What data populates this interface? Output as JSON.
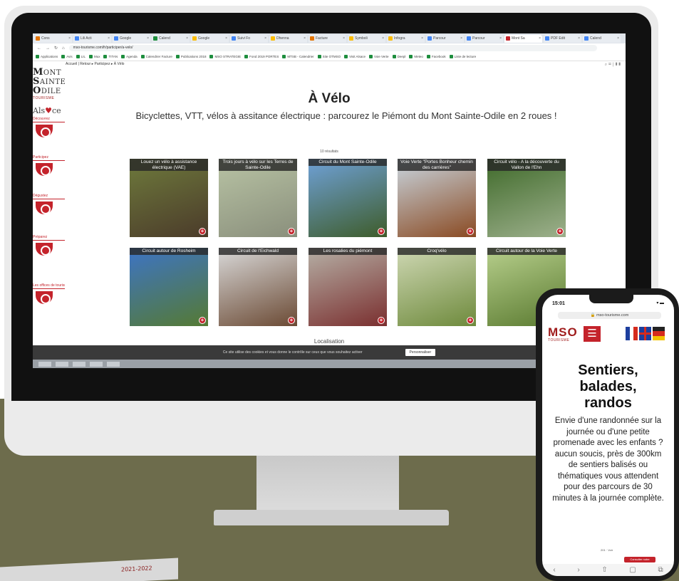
{
  "browser": {
    "tabs": [
      {
        "label": "Cons",
        "color": "#e37400"
      },
      {
        "label": "Lili Acti",
        "color": "#4285f4"
      },
      {
        "label": "Google",
        "color": "#4285f4"
      },
      {
        "label": "Calend",
        "color": "#1e8e3e"
      },
      {
        "label": "Google",
        "color": "#fbbc04"
      },
      {
        "label": "Suivi Fo",
        "color": "#4285f4"
      },
      {
        "label": "Dhenna",
        "color": "#fbbc04"
      },
      {
        "label": "Facture",
        "color": "#e37400"
      },
      {
        "label": "Symboli",
        "color": "#fbbc04"
      },
      {
        "label": "Infogra",
        "color": "#fbbc04"
      },
      {
        "label": "Parcour",
        "color": "#4285f4"
      },
      {
        "label": "Parcour",
        "color": "#4285f4"
      },
      {
        "label": "Mont Sa",
        "color": "#c4232b",
        "active": true
      },
      {
        "label": "PDF Edit",
        "color": "#4285f4"
      },
      {
        "label": "Calend",
        "color": "#4285f4"
      }
    ],
    "url": "mso-tourisme.com/fr/participer/a-velo/",
    "bookmarks": [
      "Applications",
      "Avis",
      "LIL",
      "Mux",
      "TITAN",
      "Agenda",
      "Calendrier Facture",
      "Publications 2018",
      "MSO STRATEGIE",
      "Fond 2019 PORTES",
      "MTSB - Calendrier",
      "Site OTMSO",
      "Visit Alsace",
      "Voie Verte",
      "Deepl",
      "Meteo",
      "Facebook",
      "Liste de lecture"
    ]
  },
  "site": {
    "breadcrumb": "Accueil | Retour ▸ Participez ▸ À Vélo",
    "header_icons": "⌕ ✉ | ▮▮",
    "logo": {
      "lines": [
        {
          "cap": "M",
          "rest": "ONT"
        },
        {
          "cap": "S",
          "rest": "AINTE"
        },
        {
          "cap": "O",
          "rest": "DILE"
        }
      ],
      "tourisme": "TOURISME",
      "alsace_pre": "Als",
      "alsace_heart": "♥",
      "alsace_post": "ce"
    },
    "sidebar": [
      {
        "label": "Découvrez",
        "icon": "camera-icon"
      },
      {
        "label": "Participez",
        "icon": "bike-icon"
      },
      {
        "label": "Dégustez",
        "icon": "grapes-icon"
      },
      {
        "label": "Préparez",
        "icon": "suitcase-icon"
      },
      {
        "label": "Les offices de tourisme",
        "icon": "info-icon"
      }
    ],
    "title": "À Vélo",
    "subtitle": "Bicyclettes, VTT, vélos à assitance électrique : parcourez le Piémont du Mont Sainte-Odile en 2 roues !",
    "results": "10 résultats",
    "cards": [
      {
        "label": "Louez un vélo à assistance électrique (VAE)",
        "colors": [
          "#6e7a3c",
          "#4b3b2a"
        ]
      },
      {
        "label": "Trois jours à vélo sur les Terres de Sainte-Odile",
        "colors": [
          "#b8c3a4",
          "#8a8f7c"
        ]
      },
      {
        "label": "Circuit du Mont Sainte-Odile",
        "colors": [
          "#6fa1d8",
          "#3e5c2a"
        ]
      },
      {
        "label": "Voie Verte \"Portes Bonheur chemin des carrières\"",
        "colors": [
          "#c9d6e0",
          "#8a4a22"
        ]
      },
      {
        "label": "Circuit vélo - A la découverte du Vallon de l'Ehn",
        "colors": [
          "#3f6a2a",
          "#9db08c"
        ]
      },
      {
        "label": "Circuit autour de Rosheim",
        "colors": [
          "#3d74c6",
          "#557a33"
        ]
      },
      {
        "label": "Circuit de l'Eichwald",
        "colors": [
          "#d9d9d9",
          "#6b4a34"
        ]
      },
      {
        "label": "Les rosalies du piémont",
        "colors": [
          "#b6b0a6",
          "#7a2f2f"
        ]
      },
      {
        "label": "Croq'vélo",
        "colors": [
          "#cfd8b4",
          "#6e8a3c"
        ]
      },
      {
        "label": "Circuit autour de la Voie Verte",
        "colors": [
          "#b7cf8c",
          "#5a7a30"
        ]
      }
    ],
    "localisation": "Localisation",
    "cookie_text": "Ce site utilise des cookies et vous donne le contrôle sur ceux que vous souhaitez activer",
    "cookie_button": "Personnaliser"
  },
  "phone": {
    "time": "15:01",
    "status_right": "▾ ▬",
    "url": "🔒 mso-tourisme.com",
    "logo": "MSO",
    "logo_sub": "TOURISME",
    "menu": "☰",
    "title_lines": [
      "Sentiers,",
      "balades,",
      "randos"
    ],
    "text": "Envie d'une randonnée sur la journée ou d'une petite promenade avec les enfants ? aucun soucis, près de 300km de sentiers balisés ou thématiques vous attendent pour des parcours de 30 minutes à la journée complète.",
    "mini": "201 · Voir",
    "badge": "Consulter notre brochure",
    "toolbar": [
      "‹",
      "›",
      "⇧",
      "▢",
      "⧉"
    ]
  },
  "brochure": {
    "year": "2021-2022"
  }
}
